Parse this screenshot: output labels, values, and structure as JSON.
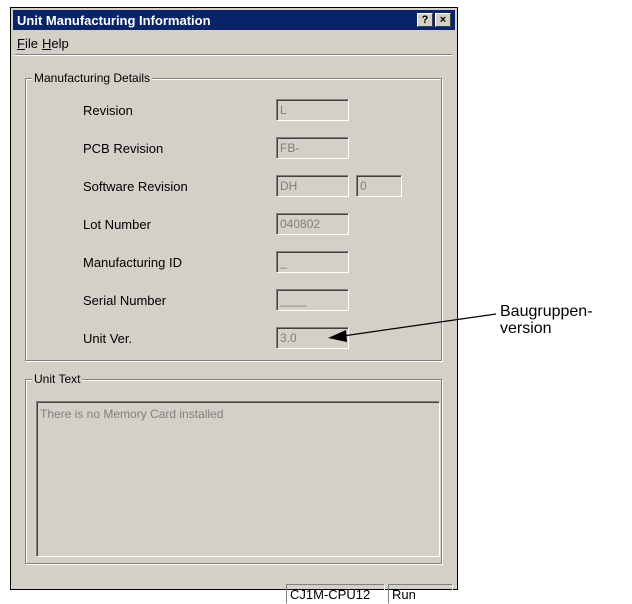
{
  "window": {
    "title": "Unit Manufacturing Information",
    "help_button": "?",
    "close_button": "×"
  },
  "menu": {
    "file": {
      "accel": "F",
      "rest": "ile"
    },
    "help": {
      "accel": "H",
      "rest": "elp"
    }
  },
  "manufacturing": {
    "legend": "Manufacturing Details",
    "rows": [
      {
        "label": "Revision",
        "value": "L"
      },
      {
        "label": "PCB Revision",
        "value": "FB-"
      },
      {
        "label": "Software Revision",
        "value": "DH",
        "value2": "0"
      },
      {
        "label": "Lot Number",
        "value": "040802"
      },
      {
        "label": "Manufacturing ID",
        "value": "_"
      },
      {
        "label": "Serial Number",
        "value": "____"
      },
      {
        "label": "Unit Ver.",
        "value": "3.0"
      }
    ]
  },
  "unit_text": {
    "legend": "Unit Text",
    "content": "There is no Memory Card installed"
  },
  "statusbar": {
    "model": "CJ1M-CPU12",
    "mode": "Run"
  },
  "annotation": {
    "line1": "Baugruppen-",
    "line2": "version"
  }
}
